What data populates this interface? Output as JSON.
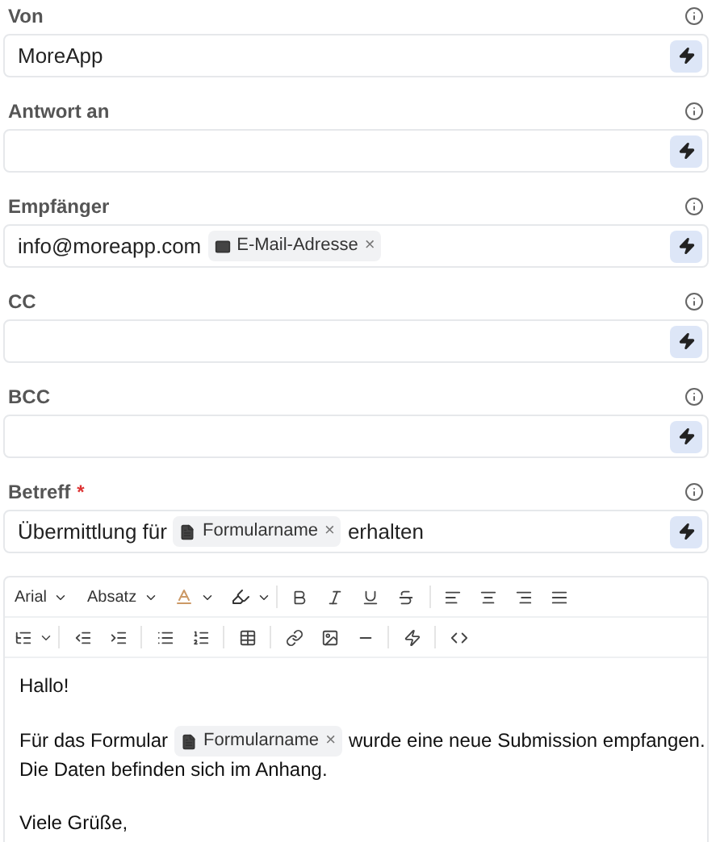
{
  "fields": [
    {
      "label": "Von",
      "segments": [
        {
          "kind": "text",
          "text": "MoreApp"
        }
      ]
    },
    {
      "label": "Antwort an"
    },
    {
      "label": "Empfänger",
      "segments": [
        {
          "kind": "text",
          "text": "info@moreapp.com"
        },
        {
          "kind": "email_chip",
          "text": "E-Mail-Adresse",
          "remove": "×"
        }
      ]
    },
    {
      "label": "CC"
    },
    {
      "label": "BCC"
    },
    {
      "label": "Betreff",
      "required_mark": "*",
      "segments": [
        {
          "kind": "text",
          "text": "Übermittlung für"
        },
        {
          "kind": "form_chip",
          "text": "Formularname",
          "remove": "×"
        },
        {
          "kind": "text",
          "text": "erhalten"
        }
      ]
    }
  ],
  "editor": {
    "font": "Arial",
    "block_format": "Absatz",
    "paragraphs": [
      [
        [
          {
            "kind": "text",
            "text": "Hallo!"
          }
        ]
      ],
      [
        [
          {
            "kind": "text",
            "text": "Für das Formular"
          },
          {
            "kind": "form_chip",
            "text": "Formularname",
            "remove": "×"
          },
          {
            "kind": "text",
            "text": "wurde eine neue Submission empfangen."
          }
        ],
        [
          {
            "kind": "text",
            "text": "Die Daten befinden sich im Anhang."
          }
        ]
      ],
      [
        [
          {
            "kind": "text",
            "text": "Viele Grüße,"
          }
        ]
      ]
    ]
  }
}
